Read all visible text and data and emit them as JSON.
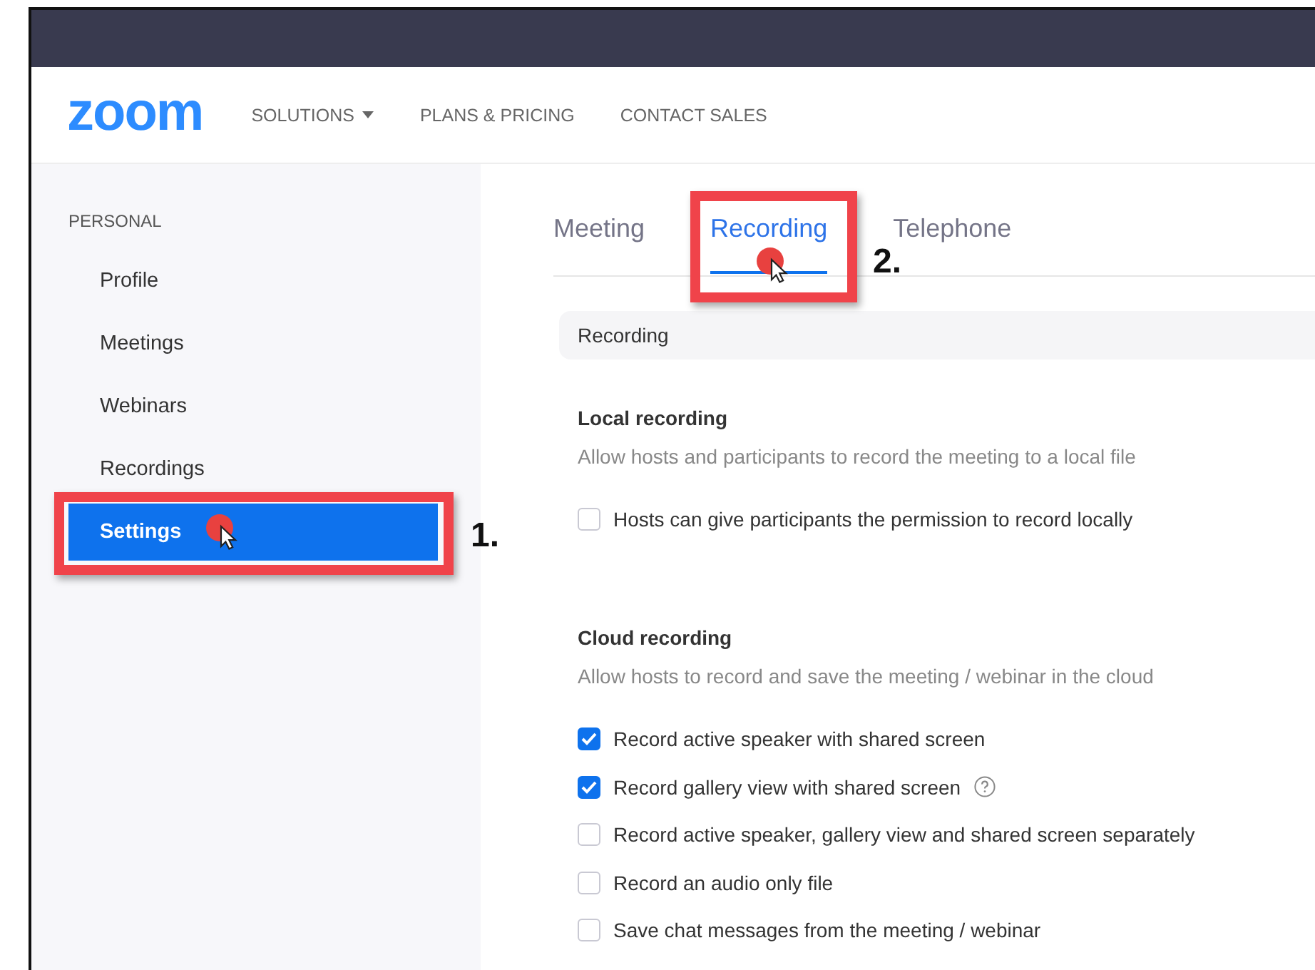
{
  "header": {
    "logo": "zoom",
    "nav": [
      {
        "label": "SOLUTIONS",
        "dropdown": true
      },
      {
        "label": "PLANS & PRICING",
        "dropdown": false
      },
      {
        "label": "CONTACT SALES",
        "dropdown": false
      }
    ]
  },
  "sidebar": {
    "heading": "PERSONAL",
    "items": [
      {
        "label": "Profile",
        "selected": false
      },
      {
        "label": "Meetings",
        "selected": false
      },
      {
        "label": "Webinars",
        "selected": false
      },
      {
        "label": "Recordings",
        "selected": false
      },
      {
        "label": "Settings",
        "selected": true
      }
    ]
  },
  "tabs": [
    {
      "label": "Meeting",
      "selected": false
    },
    {
      "label": "Recording",
      "selected": true
    },
    {
      "label": "Telephone",
      "selected": false
    }
  ],
  "section_bar": "Recording",
  "groups": [
    {
      "title": "Local recording",
      "description": "Allow hosts and participants to record the meeting to a local file",
      "options": [
        {
          "label": "Hosts can give participants the permission to record locally",
          "checked": false,
          "help": false
        }
      ]
    },
    {
      "title": "Cloud recording",
      "description": "Allow hosts to record and save the meeting / webinar in the cloud",
      "options": [
        {
          "label": "Record active speaker with shared screen",
          "checked": true,
          "help": false
        },
        {
          "label": "Record gallery view with shared screen",
          "checked": true,
          "help": true
        },
        {
          "label": "Record active speaker, gallery view and shared screen separately",
          "checked": false,
          "help": false
        },
        {
          "label": "Record an audio only file",
          "checked": false,
          "help": false
        },
        {
          "label": "Save chat messages from the meeting / webinar",
          "checked": false,
          "help": false
        }
      ]
    }
  ],
  "annotations": [
    {
      "label": "1."
    },
    {
      "label": "2."
    }
  ]
}
